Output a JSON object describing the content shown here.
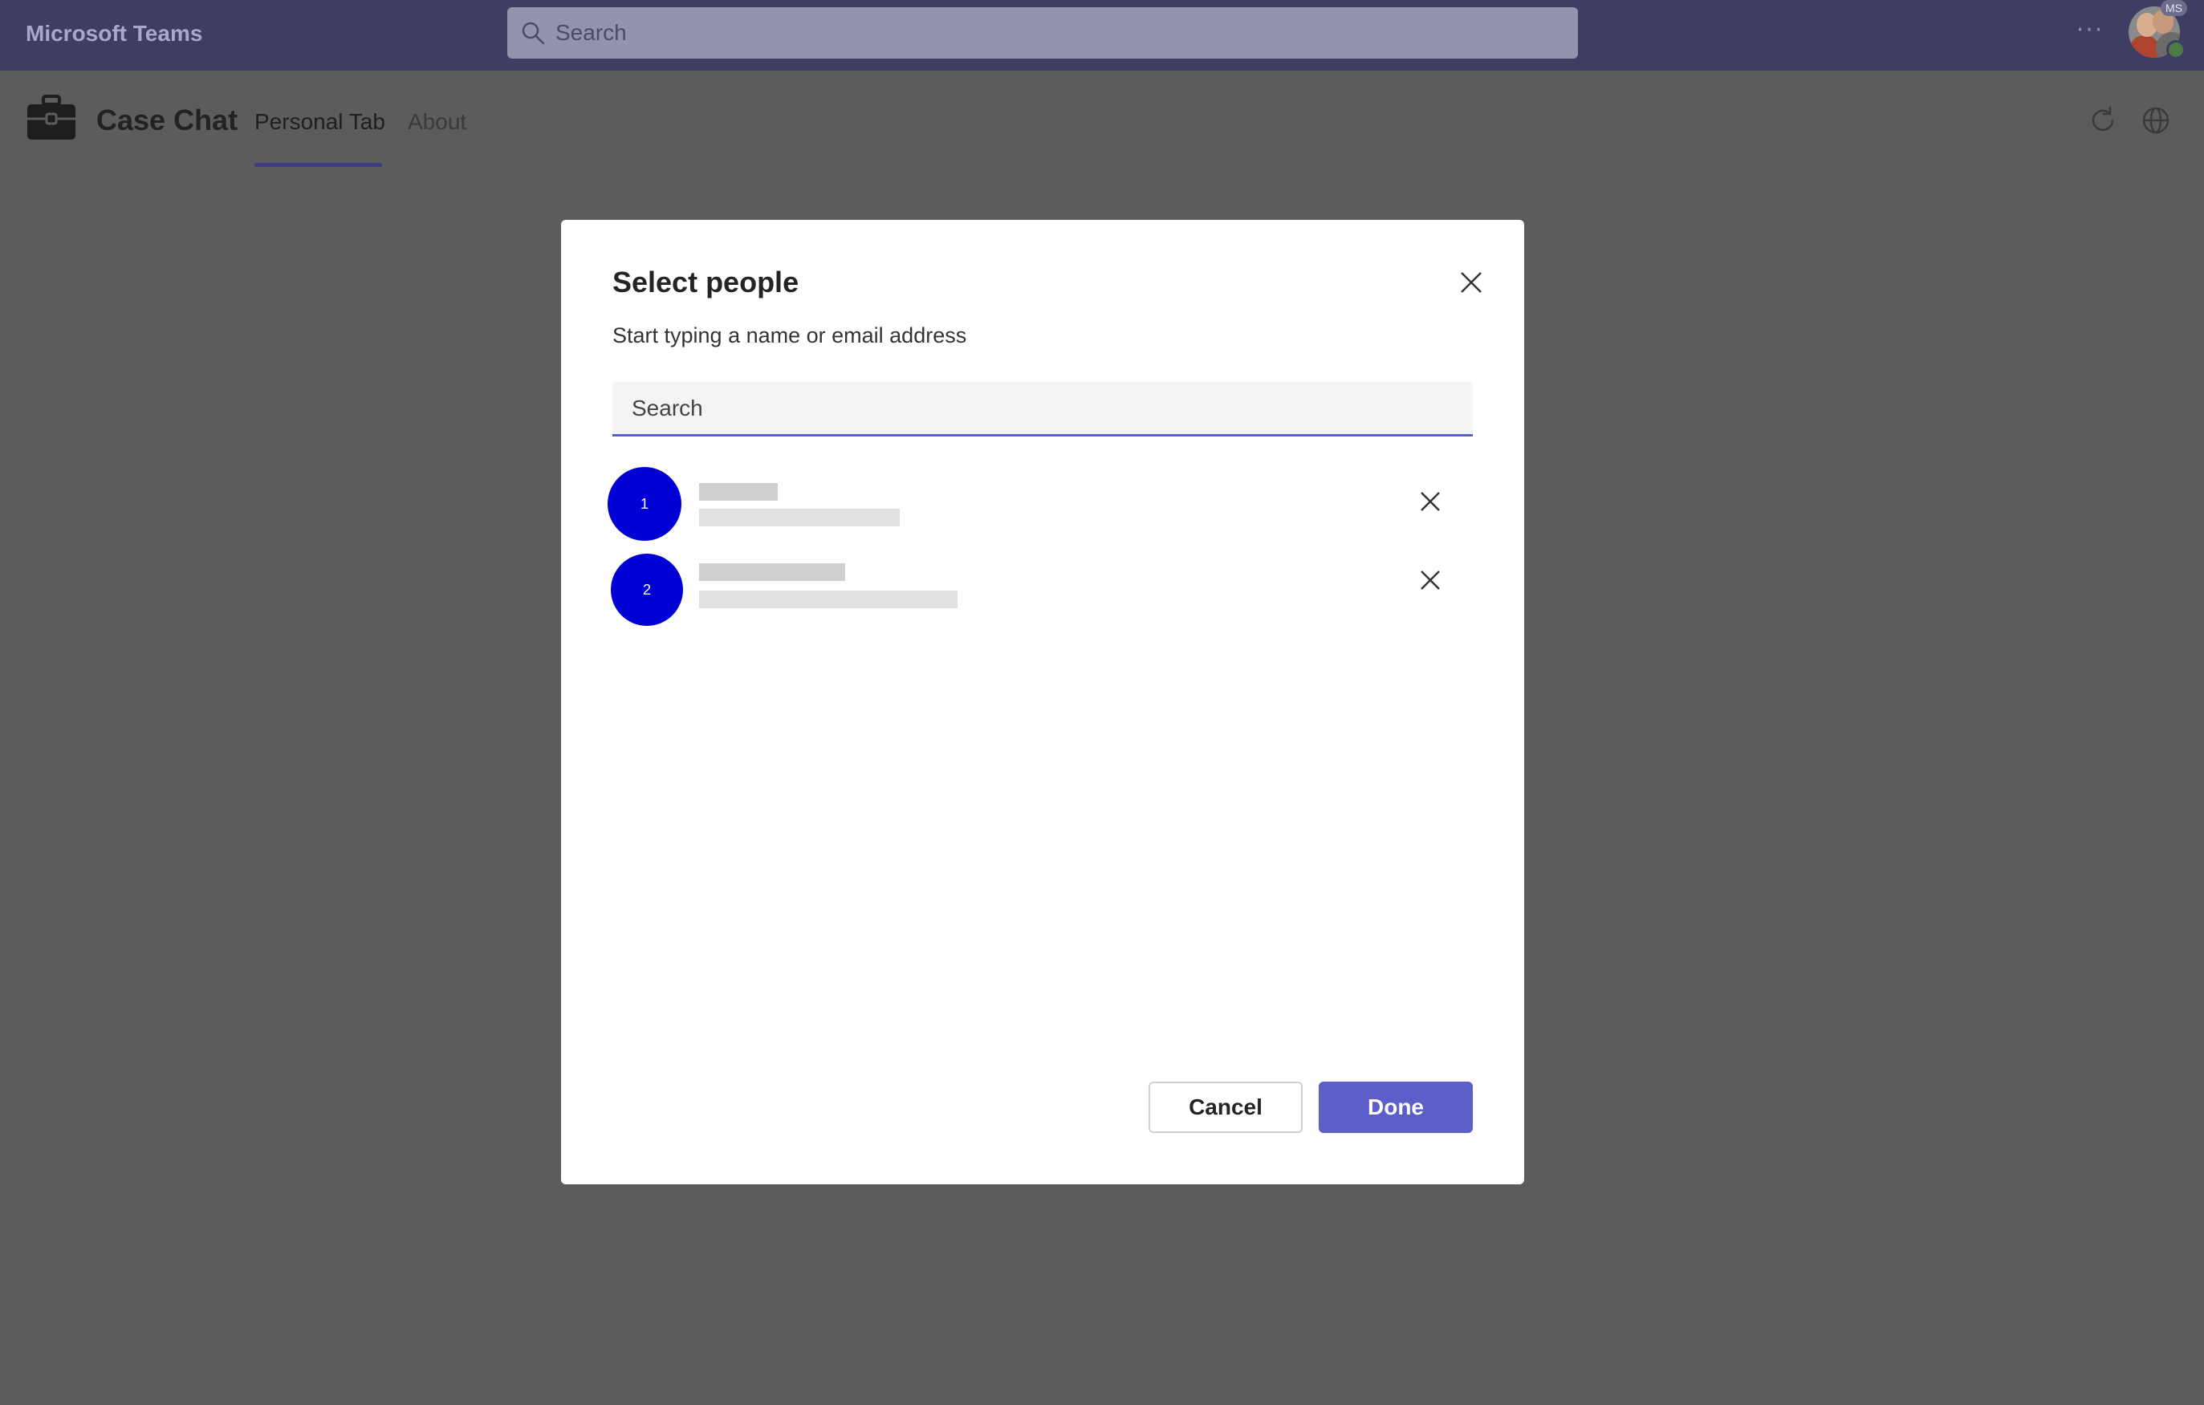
{
  "topbar": {
    "app_name": "Microsoft Teams",
    "search_placeholder": "Search",
    "more_label": "···",
    "account_badge": "MS"
  },
  "app": {
    "title": "Case Chat",
    "tabs": [
      {
        "label": "Personal Tab",
        "active": true
      },
      {
        "label": "About",
        "active": false
      }
    ]
  },
  "dialog": {
    "title": "Select people",
    "subtitle": "Start typing a name or email address",
    "search_placeholder": "Search",
    "people": [
      {
        "avatar_text": "1"
      },
      {
        "avatar_text": "2"
      }
    ],
    "cancel_label": "Cancel",
    "done_label": "Done"
  },
  "colors": {
    "topbar": "#3e3d63",
    "accent": "#5b5fc7",
    "avatar": "#0000d4",
    "overlay": "#5c5c5c"
  }
}
